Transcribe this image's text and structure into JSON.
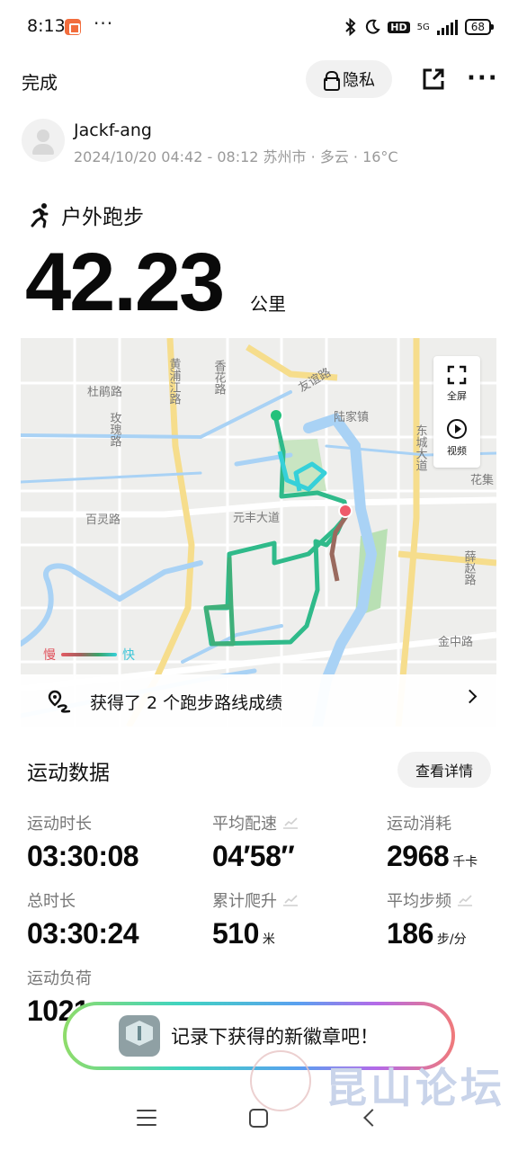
{
  "status_bar": {
    "time": "8:13",
    "dots": "···",
    "network": "5G",
    "hd": "HD",
    "battery": "68"
  },
  "header": {
    "done_label": "完成",
    "privacy_label": "隐私",
    "more_label": "···"
  },
  "user": {
    "name": "Jackf-ang",
    "meta": "2024/10/20 04:42 - 08:12 苏州市 · 多云 · 16°C"
  },
  "activity": {
    "type": "户外跑步",
    "distance": "42.23",
    "distance_unit": "公里"
  },
  "map": {
    "labels": {
      "dupeng_road": "杜鹃路",
      "meigui_road": "玫瑰路",
      "bailing_road": "百灵路",
      "huangpujiang_road": "黄浦江路",
      "xianghua_road": "香花路",
      "youyi_road": "友谊路",
      "lujia_town": "陆家镇",
      "dongcheng_avenue": "东城大道",
      "yuanfeng_avenue": "元丰大道",
      "huaji": "花集",
      "xuezhao_road": "薛赵路",
      "jinzhong_road": "金中路"
    },
    "fullscreen_label": "全屏",
    "video_label": "视频",
    "legend_slow": "慢",
    "legend_fast": "快",
    "colors": {
      "water": "#a9d2f5",
      "road": "#f6dd8c",
      "park": "#c9e5c2",
      "start": "#23c17b",
      "end": "#ef5b6a"
    }
  },
  "achievement": {
    "text": "获得了 2 个跑步路线成绩"
  },
  "stats": {
    "title": "运动数据",
    "details_label": "查看详情",
    "items": [
      {
        "label": "运动时长",
        "value": "03:30:08",
        "unit": ""
      },
      {
        "label": "平均配速",
        "value": "04′58″",
        "unit": ""
      },
      {
        "label": "运动消耗",
        "value": "2968",
        "unit": "千卡"
      },
      {
        "label": "总时长",
        "value": "03:30:24",
        "unit": ""
      },
      {
        "label": "累计爬升",
        "value": "510",
        "unit": "米"
      },
      {
        "label": "平均步频",
        "value": "186",
        "unit": "步/分"
      },
      {
        "label": "运动负荷",
        "value": "1021",
        "unit": ""
      }
    ]
  },
  "toast": {
    "text": "记录下获得的新徽章吧！"
  },
  "watermark": {
    "text": "昆山论坛"
  }
}
